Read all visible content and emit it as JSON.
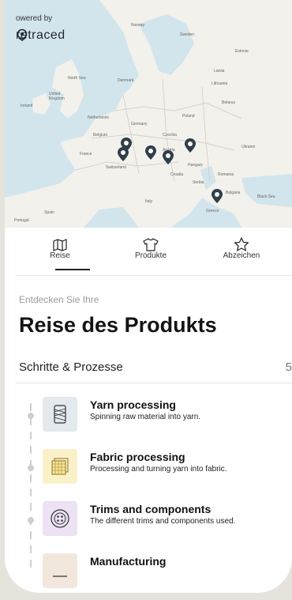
{
  "map": {
    "powered_by": "owered by",
    "brand": "retraced",
    "labels": [
      "Norway",
      "Sweden",
      "Estonia",
      "Latvia",
      "Lithuania",
      "Denmark",
      "United Kingdom",
      "Ireland",
      "Netherlands",
      "Belarus",
      "Poland",
      "Germany",
      "Belgium",
      "Czechia",
      "Ukraine",
      "France",
      "Austria",
      "Hungary",
      "Switzerland",
      "Romania",
      "Croatia",
      "Serbia",
      "Bulgaria",
      "Italy",
      "Spain",
      "Portugal",
      "Black Sea",
      "North Sea",
      "Greece"
    ]
  },
  "tabs": [
    {
      "label": "Reise",
      "icon": "map-icon"
    },
    {
      "label": "Produkte",
      "icon": "tshirt-icon"
    },
    {
      "label": "Abzeichen",
      "icon": "star-icon"
    }
  ],
  "header": {
    "subtitle": "Entdecken Sie Ihre",
    "title": "Reise des Produkts"
  },
  "steps_section": {
    "label": "Schritte & Prozesse",
    "count": "5"
  },
  "steps": [
    {
      "name": "Yarn processing",
      "desc": "Spinning raw material into yarn.",
      "icon": "yarn-icon",
      "bg": "#e4e9ee"
    },
    {
      "name": "Fabric processing",
      "desc": "Processing and turning yarn into fabric.",
      "icon": "fabric-icon",
      "bg": "#fbf1c9"
    },
    {
      "name": "Trims and components",
      "desc": "The different trims and components used.",
      "icon": "button-icon",
      "bg": "#ece2f4"
    },
    {
      "name": "Manufacturing",
      "desc": "",
      "icon": "manufacturing-icon",
      "bg": "#f1e7dc"
    }
  ],
  "colors": {
    "pin": "#2f3e4a",
    "accent": "#141414"
  }
}
